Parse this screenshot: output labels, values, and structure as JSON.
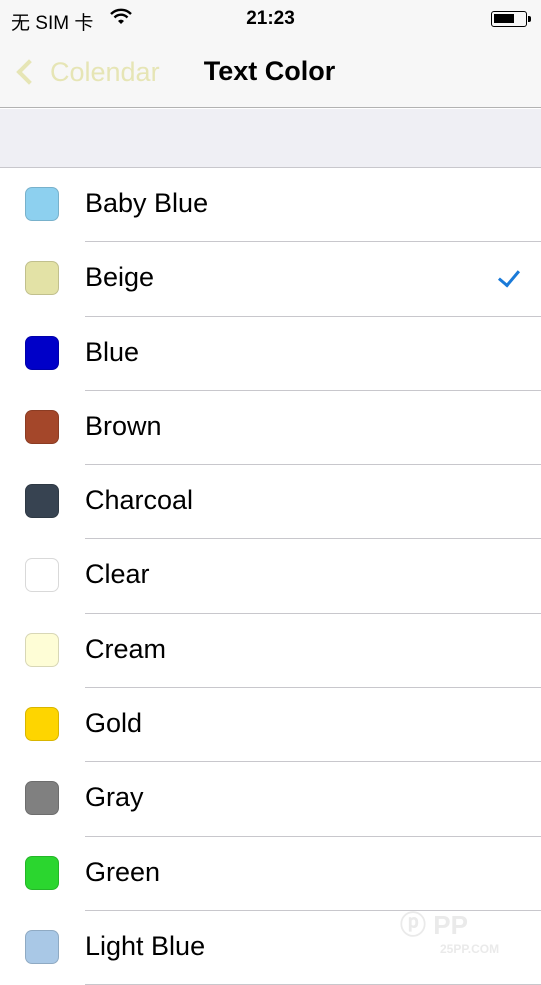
{
  "status_bar": {
    "carrier": "无 SIM 卡",
    "time": "21:23",
    "wifi_icon": "wifi-icon",
    "battery_icon": "battery-icon"
  },
  "nav": {
    "back_label": "Colendar",
    "title": "Text Color",
    "tint": "#e6e5b5"
  },
  "colors": [
    {
      "label": "Baby Blue",
      "color": "#8dd0ef",
      "selected": false
    },
    {
      "label": "Beige",
      "color": "#e3e2a6",
      "selected": true
    },
    {
      "label": "Blue",
      "color": "#0000c8",
      "selected": false
    },
    {
      "label": "Brown",
      "color": "#a4472a",
      "selected": false
    },
    {
      "label": "Charcoal",
      "color": "#374351",
      "selected": false
    },
    {
      "label": "Clear",
      "color": "#ffffff",
      "selected": false
    },
    {
      "label": "Cream",
      "color": "#fefdd6",
      "selected": false
    },
    {
      "label": "Gold",
      "color": "#fed500",
      "selected": false
    },
    {
      "label": "Gray",
      "color": "#808080",
      "selected": false
    },
    {
      "label": "Green",
      "color": "#2bd62f",
      "selected": false
    },
    {
      "label": "Light Blue",
      "color": "#a9c8e6",
      "selected": false
    }
  ],
  "check_color": "#1a7ad8",
  "watermark": {
    "text": "PP助手",
    "sub": "25PP.COM"
  }
}
